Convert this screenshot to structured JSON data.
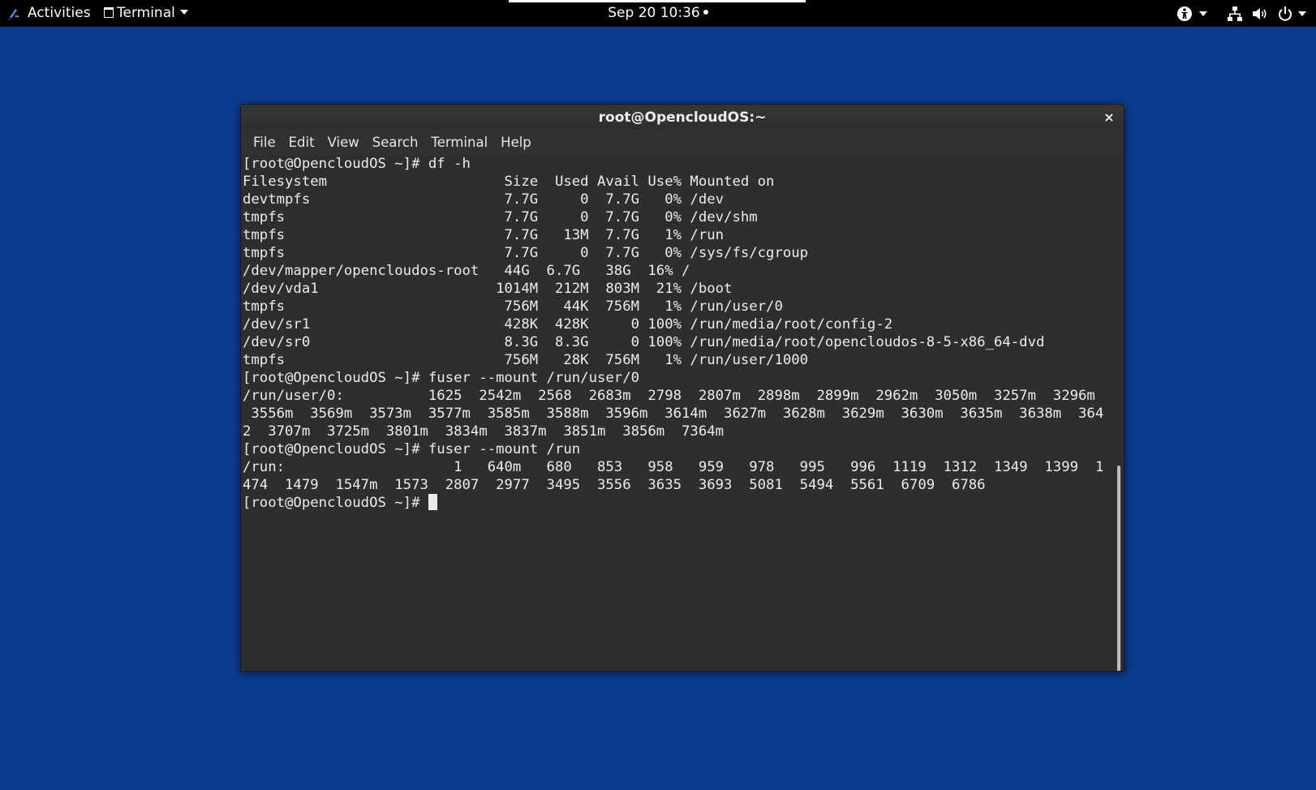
{
  "topbar": {
    "activities_label": "Activities",
    "app_menu_label": "Terminal",
    "clock": "Sep 20  10:36",
    "icons": [
      "accessibility-icon",
      "network-icon",
      "volume-icon",
      "power-icon"
    ]
  },
  "window": {
    "title": "root@OpencloudOS:~",
    "close_label": "×",
    "menu": {
      "file": "File",
      "edit": "Edit",
      "view": "View",
      "search": "Search",
      "terminal": "Terminal",
      "help": "Help"
    }
  },
  "terminal": {
    "lines": [
      "[root@OpencloudOS ~]# df -h",
      "Filesystem                     Size  Used Avail Use% Mounted on",
      "devtmpfs                       7.7G     0  7.7G   0% /dev",
      "tmpfs                          7.7G     0  7.7G   0% /dev/shm",
      "tmpfs                          7.7G   13M  7.7G   1% /run",
      "tmpfs                          7.7G     0  7.7G   0% /sys/fs/cgroup",
      "/dev/mapper/opencloudos-root   44G  6.7G   38G  16% /",
      "/dev/vda1                     1014M  212M  803M  21% /boot",
      "tmpfs                          756M   44K  756M   1% /run/user/0",
      "/dev/sr1                       428K  428K     0 100% /run/media/root/config-2",
      "/dev/sr0                       8.3G  8.3G     0 100% /run/media/root/opencloudos-8-5-x86_64-dvd",
      "tmpfs                          756M   28K  756M   1% /run/user/1000",
      "[root@OpencloudOS ~]# fuser --mount /run/user/0",
      "/run/user/0:          1625  2542m  2568  2683m  2798  2807m  2898m  2899m  2962m  3050m  3257m  3296m",
      " 3556m  3569m  3573m  3577m  3585m  3588m  3596m  3614m  3627m  3628m  3629m  3630m  3635m  3638m  364",
      "2  3707m  3725m  3801m  3834m  3837m  3851m  3856m  7364m",
      "[root@OpencloudOS ~]# fuser --mount /run",
      "/run:                    1   640m   680   853   958   959   978   995   996  1119  1312  1349  1399  1",
      "474  1479  1547m  1573  2807  2977  3495  3556  3635  3693  5081  5494  5561  6709  6786"
    ],
    "prompt": "[root@OpencloudOS ~]# "
  }
}
